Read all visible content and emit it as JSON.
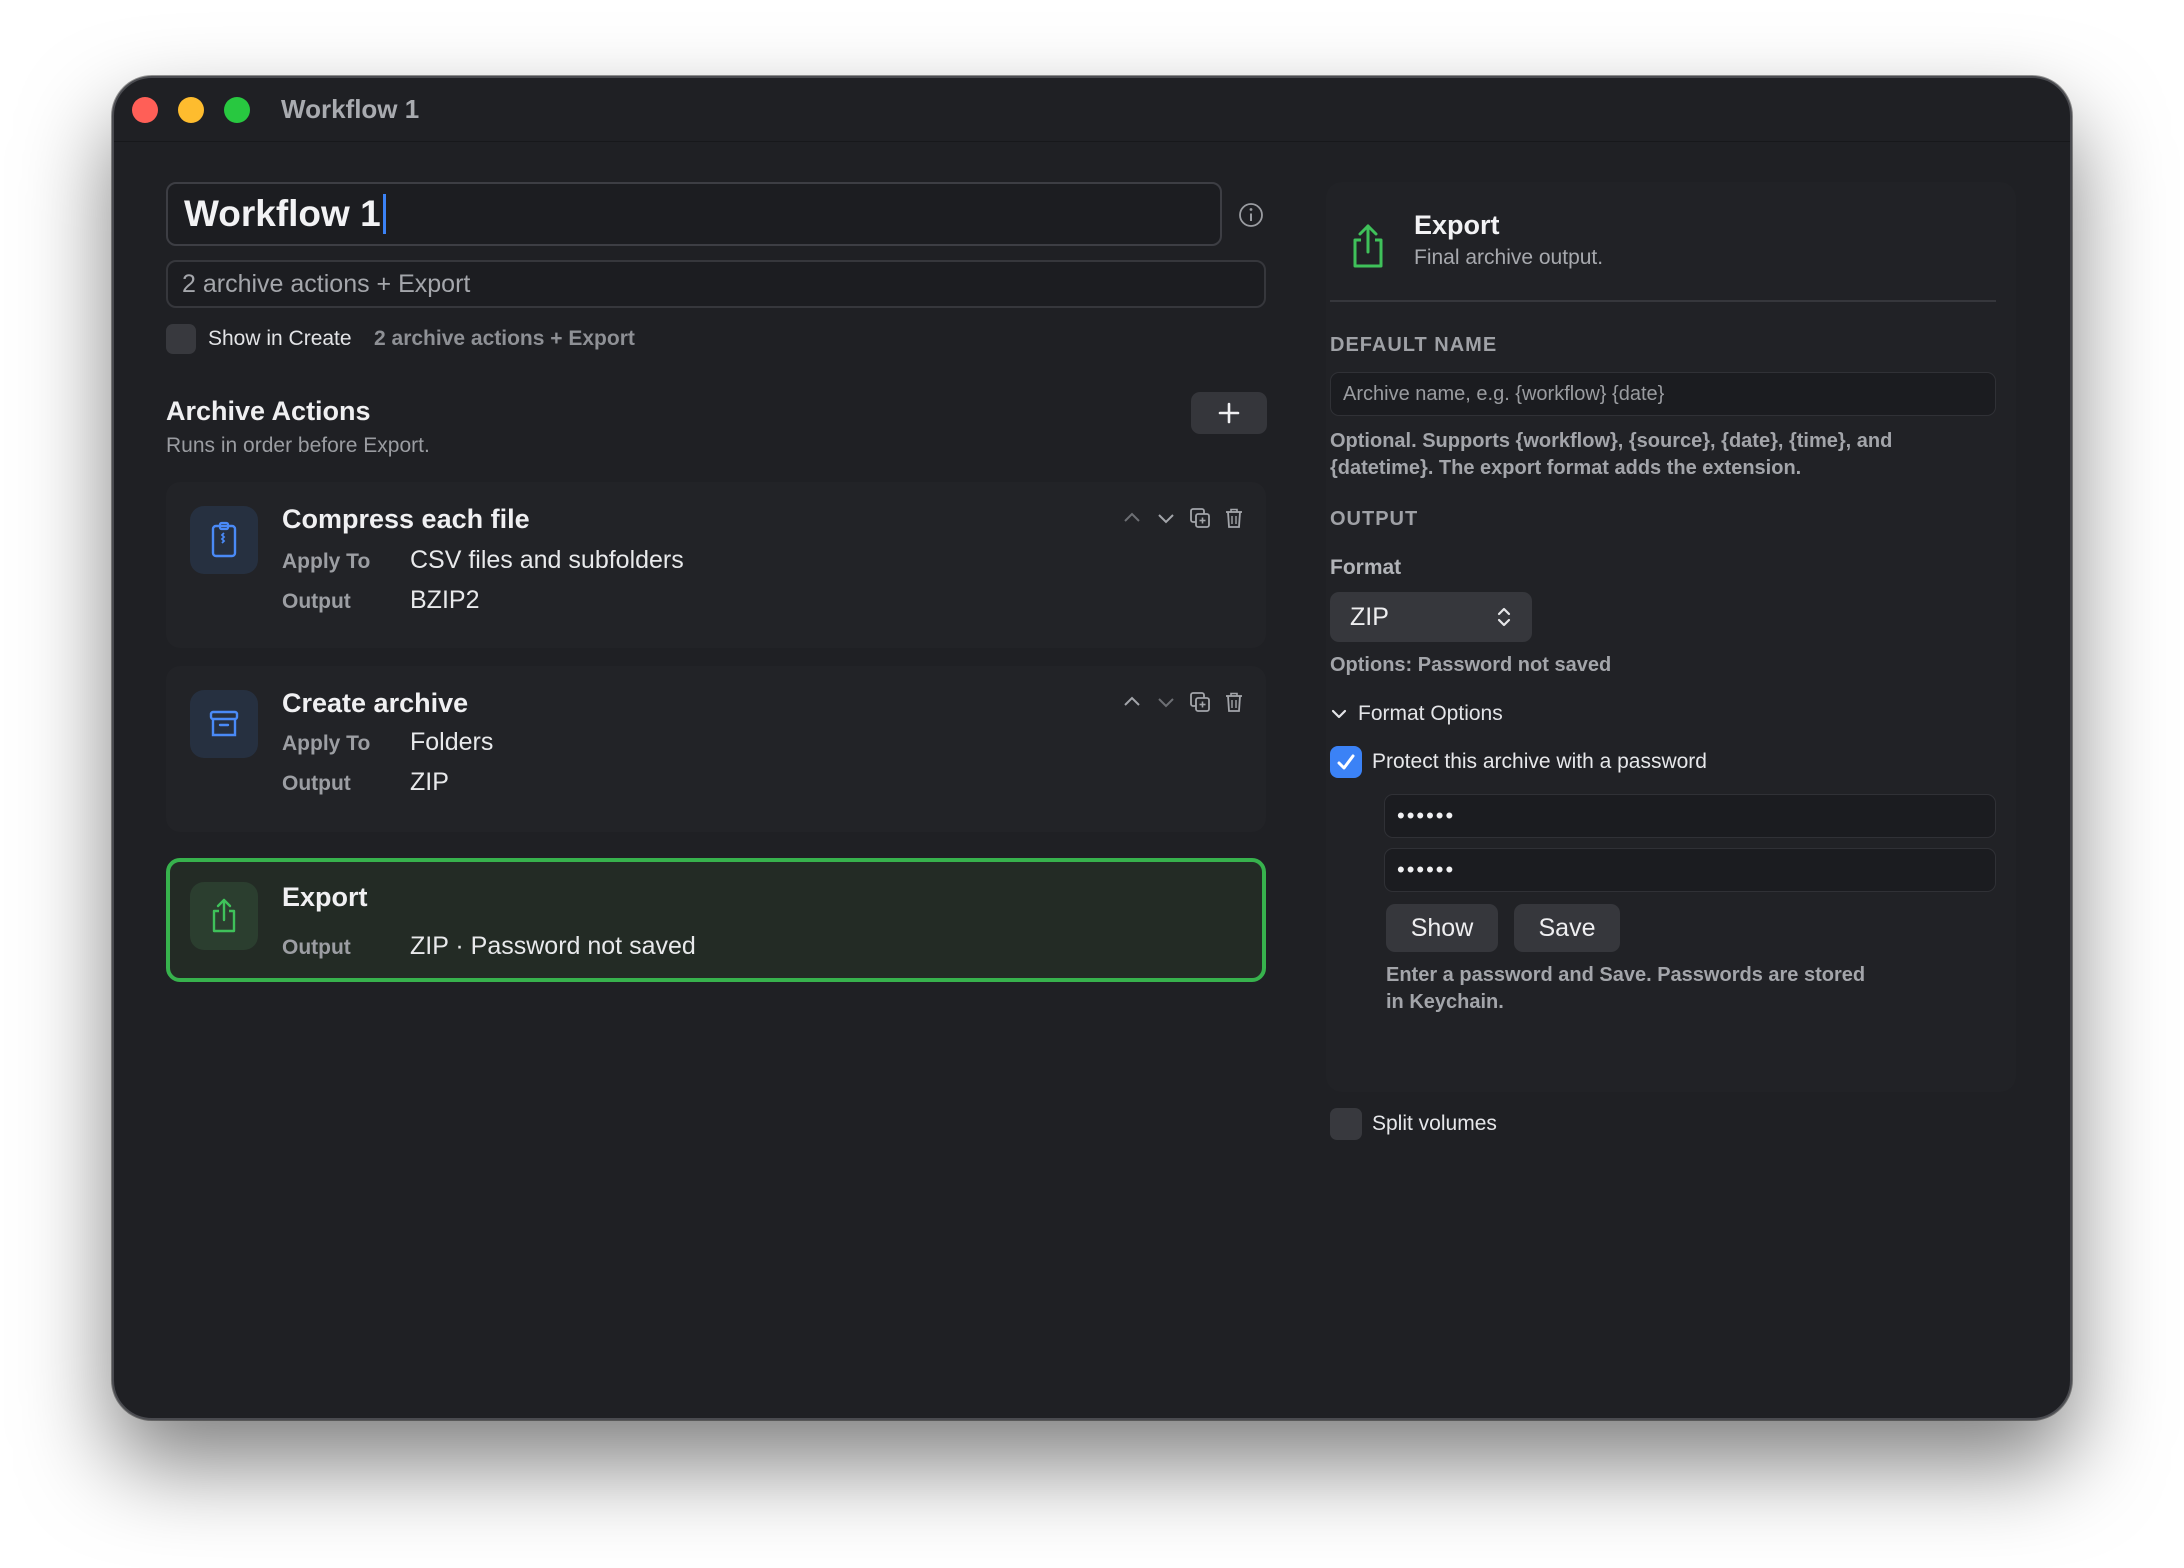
{
  "window": {
    "title": "Workflow 1"
  },
  "workflow": {
    "name": "Workflow 1",
    "description": "2 archive actions + Export",
    "show_in_create_label": "Show in Create",
    "show_in_create_checked": false,
    "summary": "2 archive actions + Export"
  },
  "archive_actions": {
    "title": "Archive Actions",
    "subtitle": "Runs in order before Export.",
    "cards": [
      {
        "title": "Compress each file",
        "icon": "zip-file-icon",
        "rows": [
          {
            "key": "Apply To",
            "value": "CSV files and subfolders"
          },
          {
            "key": "Output",
            "value": "BZIP2"
          }
        ]
      },
      {
        "title": "Create archive",
        "icon": "archive-box-icon",
        "rows": [
          {
            "key": "Apply To",
            "value": "Folders"
          },
          {
            "key": "Output",
            "value": "ZIP"
          }
        ]
      }
    ],
    "export_card": {
      "title": "Export",
      "icon": "share-icon",
      "rows": [
        {
          "key": "Output",
          "value": "ZIP · Password not saved"
        }
      ]
    }
  },
  "inspector": {
    "title": "Export",
    "subtitle": "Final archive output.",
    "default_name_label": "DEFAULT NAME",
    "default_name_placeholder": "Archive name, e.g. {workflow} {date}",
    "default_name_help_1": "Optional. Supports {workflow}, {source}, {date}, {time}, and",
    "default_name_help_2": "{datetime}. The export format adds the extension.",
    "output_label": "OUTPUT",
    "format_label": "Format",
    "format_value": "ZIP",
    "options_summary": "Options: Password not saved",
    "format_options_label": "Format Options",
    "protect_label": "Protect this archive with a password",
    "protect_checked": true,
    "password_masked": "••••••",
    "confirm_masked": "••••••",
    "show_button": "Show",
    "save_button": "Save",
    "password_help_1": "Enter a password and Save. Passwords are stored",
    "password_help_2": "in Keychain.",
    "split_label": "Split volumes",
    "split_checked": false
  },
  "colors": {
    "accent_blue": "#3b82f6",
    "export_green": "#37b24d",
    "window_bg": "#1f2024"
  }
}
